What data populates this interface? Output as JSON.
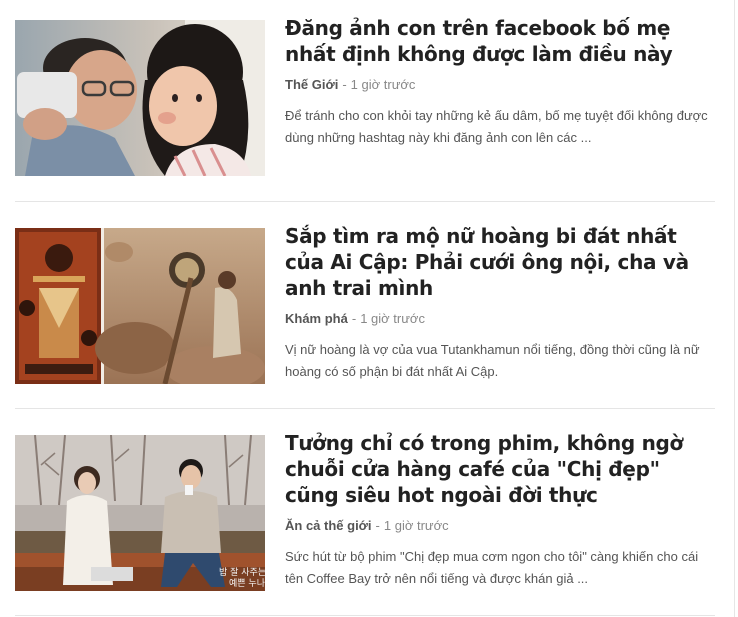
{
  "articles": [
    {
      "title": "Đăng ảnh con trên facebook bố mẹ nhất định không được làm điều này",
      "category": "Thế Giới",
      "separator": "-",
      "time": "1 giờ trước",
      "sapo": "Để tránh cho con khỏi tay những kẻ ấu dâm, bố mẹ tuyệt đối không được dùng những hashtag này khi đăng ảnh con lên các ..."
    },
    {
      "title": "Sắp tìm ra mộ nữ hoàng bi đát nhất của Ai Cập: Phải cưới ông nội, cha và anh trai mình",
      "category": "Khám phá",
      "separator": "-",
      "time": "1 giờ trước",
      "sapo": "Vị nữ hoàng là vợ của vua Tutankhamun nổi tiếng, đồng thời cũng là nữ hoàng có số phận bi đát nhất Ai Cập."
    },
    {
      "title": "Tưởng chỉ có trong phim, không ngờ chuỗi cửa hàng café của \"Chị đẹp\" cũng siêu hot ngoài đời thực",
      "category": "Ăn cả thế giới",
      "separator": "-",
      "time": "1 giờ trước",
      "sapo": "Sức hút từ bộ phim \"Chị đẹp mua cơm ngon cho tôi\" càng khiến cho cái tên Coffee Bay trở nên nổi tiếng và được khán giả ...",
      "image_caption": "밥 잘 사주는 예쁜 누나"
    }
  ]
}
